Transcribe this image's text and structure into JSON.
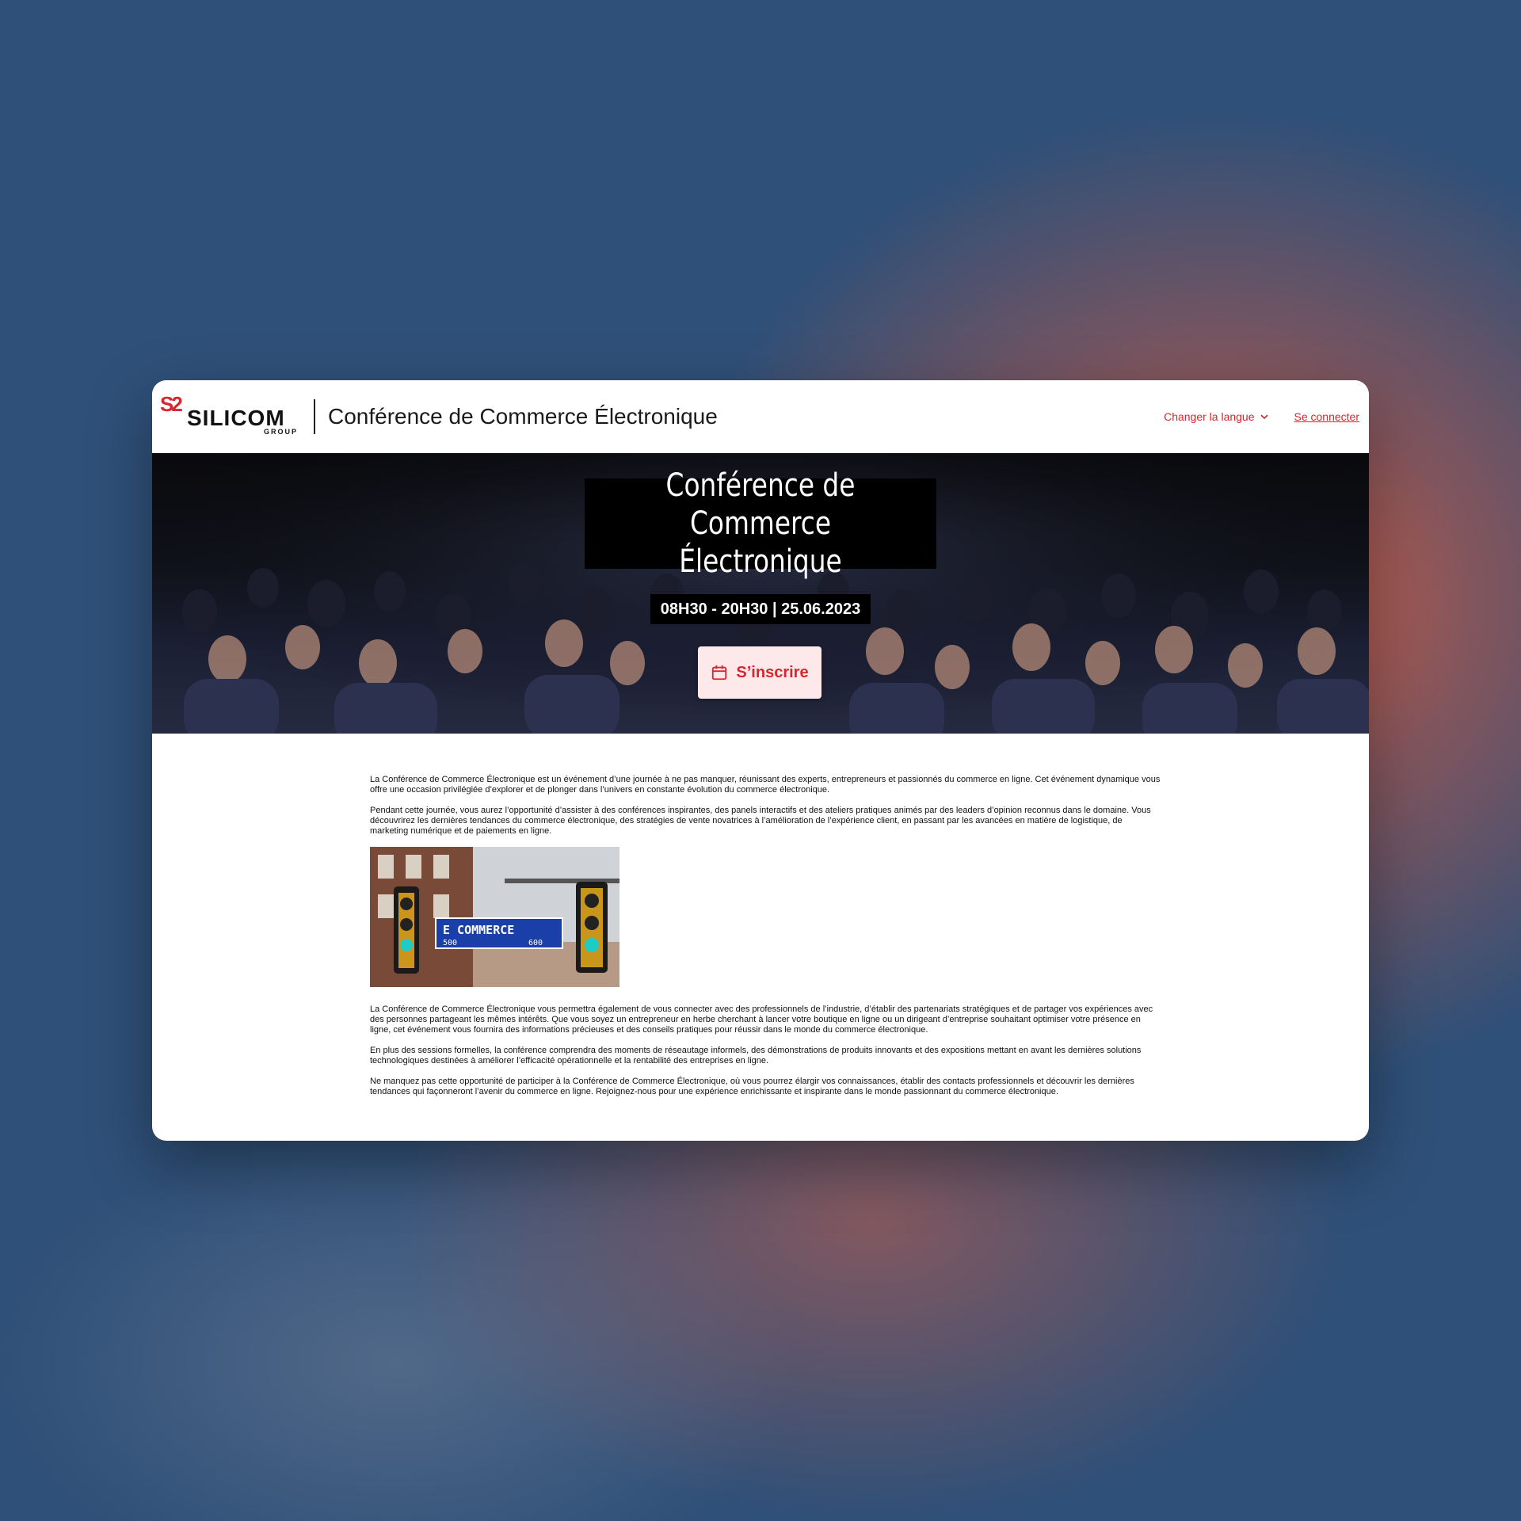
{
  "header": {
    "logo_mark": "S2",
    "logo_name": "SILICOM",
    "logo_sub": "GROUP",
    "site_title": "Conférence de Commerce Électronique",
    "language_label": "Changer la langue",
    "login_label": "Se connecter"
  },
  "hero": {
    "title_line1": "Conférence de Commerce",
    "title_line2": "Électronique",
    "time": "08H30 - 20H30 | 25.06.2023",
    "register_label": "S’inscrire"
  },
  "content": {
    "paragraphs_before": [
      "La Conférence de Commerce Électronique est un événement d’une journée à ne pas manquer, réunissant des experts, entrepreneurs et passionnés du commerce en ligne. Cet événement dynamique vous offre une occasion privilégiée d’explorer et de plonger dans l’univers en constante évolution du commerce électronique.",
      "Pendant cette journée, vous aurez l’opportunité d’assister à des conférences inspirantes, des panels interactifs et des ateliers pratiques animés par des leaders d’opinion reconnus dans le domaine. Vous découvrirez les dernières tendances du commerce électronique, des stratégies de vente novatrices à l’amélioration de l’expérience client, en passant par les avancées en matière de logistique, de marketing numérique et de paiements en ligne."
    ],
    "image": {
      "sign_text": "E COMMERCE",
      "sign_left_num": "500",
      "sign_right_num": "600"
    },
    "paragraphs_after": [
      "La Conférence de Commerce Électronique vous permettra également de vous connecter avec des professionnels de l’industrie, d’établir des partenariats stratégiques et de partager vos expériences avec des personnes partageant les mêmes intérêts. Que vous soyez un entrepreneur en herbe cherchant à lancer votre boutique en ligne ou un dirigeant d’entreprise souhaitant optimiser votre présence en ligne, cet événement vous fournira des informations précieuses et des conseils pratiques pour réussir dans le monde du commerce électronique.",
      "En plus des sessions formelles, la conférence comprendra des moments de réseautage informels, des démonstrations de produits innovants et des expositions mettant en avant les dernières solutions technologiques destinées à améliorer l’efficacité opérationnelle et la rentabilité des entreprises en ligne.",
      "Ne manquez pas cette opportunité de participer à la Conférence de Commerce Électronique, où vous pourrez élargir vos connaissances, établir des contacts professionnels et découvrir les dernières tendances qui façonneront l’avenir du commerce en ligne. Rejoignez-nous pour une expérience enrichissante et inspirante dans le monde passionnant du commerce électronique."
    ]
  },
  "colors": {
    "accent": "#d7262e",
    "register_bg": "#fde8ea"
  },
  "icons": [
    "chevron-down-icon",
    "calendar-icon"
  ]
}
